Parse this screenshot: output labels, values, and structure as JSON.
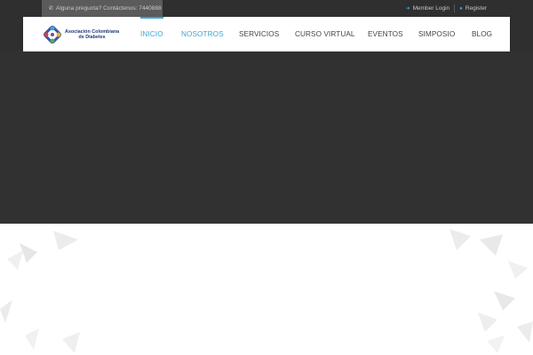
{
  "topbar": {
    "contact_text": "Alguna pregunta? Contáctenos: 7440888",
    "member_login": "Member Login",
    "register": "Register"
  },
  "header": {
    "logo_line1": "Asociación Colombiana",
    "logo_line2": "de Diabetes"
  },
  "nav": {
    "items": [
      {
        "label": "INICIO"
      },
      {
        "label": "NOSOTROS"
      },
      {
        "label": "SERVICIOS"
      },
      {
        "label": "CURSO VIRTUAL"
      },
      {
        "label": "EVENTOS"
      },
      {
        "label": "SIMPOSIO"
      },
      {
        "label": "BLOG"
      }
    ]
  },
  "colors": {
    "accent": "#3da6d1",
    "dark_bg": "#313131",
    "contact_bg": "#5b5b5b"
  },
  "icons": {
    "phone": "phone-icon",
    "login": "login-icon",
    "register": "user-icon"
  }
}
